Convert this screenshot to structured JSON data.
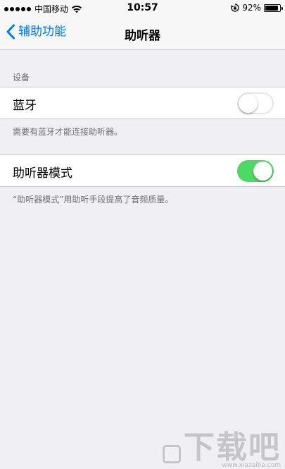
{
  "status_bar": {
    "carrier": "中国移动",
    "time": "10:57",
    "battery_percent": "92%",
    "battery_level": 0.92,
    "signal_dots": 5,
    "icons": [
      "signal-dots-icon",
      "wifi-icon",
      "rotation-lock-icon",
      "battery-icon"
    ]
  },
  "nav": {
    "back_label": "辅助功能",
    "title": "助听器"
  },
  "sections": {
    "devices": {
      "header": "设备",
      "bluetooth": {
        "label": "蓝牙",
        "on": false
      },
      "footer": "需要有蓝牙才能连接助听器。"
    },
    "hearing_aid_mode": {
      "label": "助听器模式",
      "on": true,
      "footer": "“助听器模式”用助听手段提高了音频质量。"
    }
  },
  "watermark": {
    "text": "下载吧",
    "url": "www.xiazaiba.com"
  },
  "colors": {
    "accent": "#007aff",
    "switch_on": "#4cd964",
    "background": "#efeff4"
  }
}
